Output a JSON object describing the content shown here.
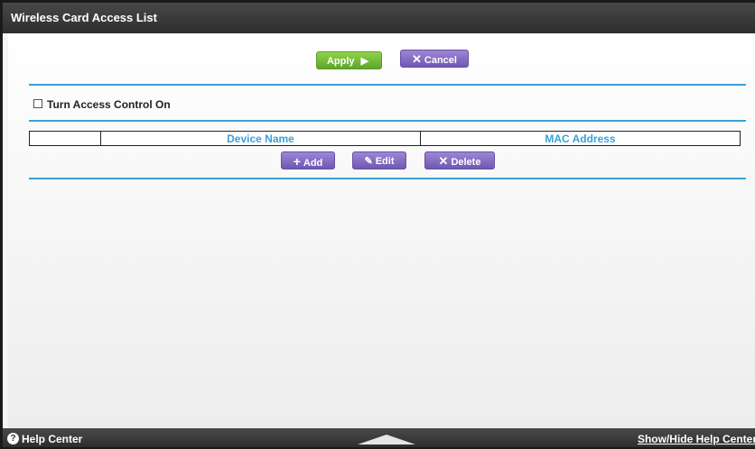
{
  "window": {
    "title": "Wireless Card Access List"
  },
  "actions": {
    "apply_label": "Apply",
    "apply_icon": "play-arrow-icon",
    "cancel_label": "Cancel",
    "cancel_icon": "x-icon"
  },
  "access_control": {
    "checkbox_label": "Turn Access Control On",
    "checked": false
  },
  "table": {
    "columns": [
      "",
      "Device Name",
      "MAC Address"
    ],
    "rows": []
  },
  "list_actions": {
    "add_label": "Add",
    "add_icon": "plus-icon",
    "edit_label": "Edit",
    "edit_icon": "pencil-icon",
    "delete_label": "Delete",
    "delete_icon": "x-icon"
  },
  "footer": {
    "help_label": "Help Center",
    "help_icon": "question-circle-icon",
    "toggle_label": "Show/Hide Help Center",
    "toggle_icon": "up-triangle-icon"
  },
  "colors": {
    "accent_blue": "#3aa0d8",
    "apply_green": "#6cb832",
    "button_purple": "#7c66c0",
    "bar_dark": "#333333"
  }
}
